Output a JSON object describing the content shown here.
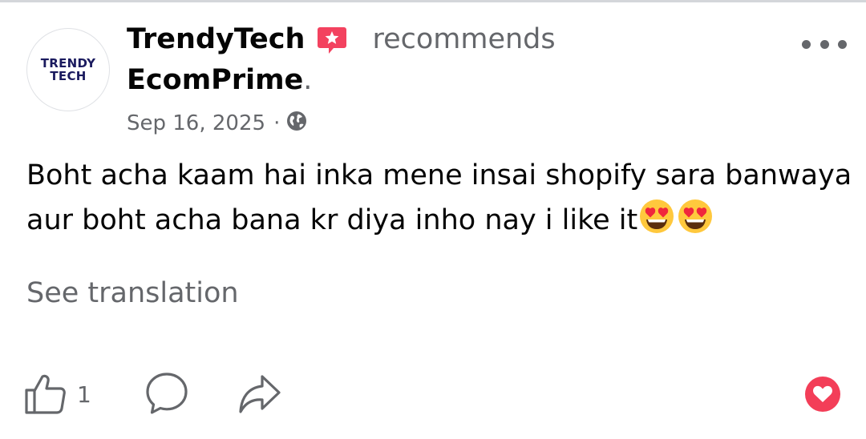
{
  "post": {
    "author": "TrendyTech",
    "avatar_line1": "TRENDY",
    "avatar_line2": "TECH",
    "action": "recommends",
    "target": "EcomPrime",
    "date": "Sep 16, 2025",
    "separator": "·",
    "body": "Boht acha kaam hai inka mene insai shopify sara banwaya aur boht acha bana kr diya inho nay i like it",
    "see_translation": "See translation",
    "like_count": "1"
  },
  "icons": {
    "recommend": "recommendation-badge-icon",
    "privacy": "globe-icon",
    "more": "more-options-icon",
    "emoji": "heart-eyes-emoji",
    "like": "thumbs-up-icon",
    "comment": "comment-icon",
    "share": "share-icon",
    "reaction": "heart-reaction-icon"
  },
  "colors": {
    "primary_text": "#050505",
    "secondary_text": "#65676b",
    "recommend_badge": "#f3425f",
    "heart_reaction": "#f33e58",
    "avatar_text": "#1a1a5e"
  }
}
